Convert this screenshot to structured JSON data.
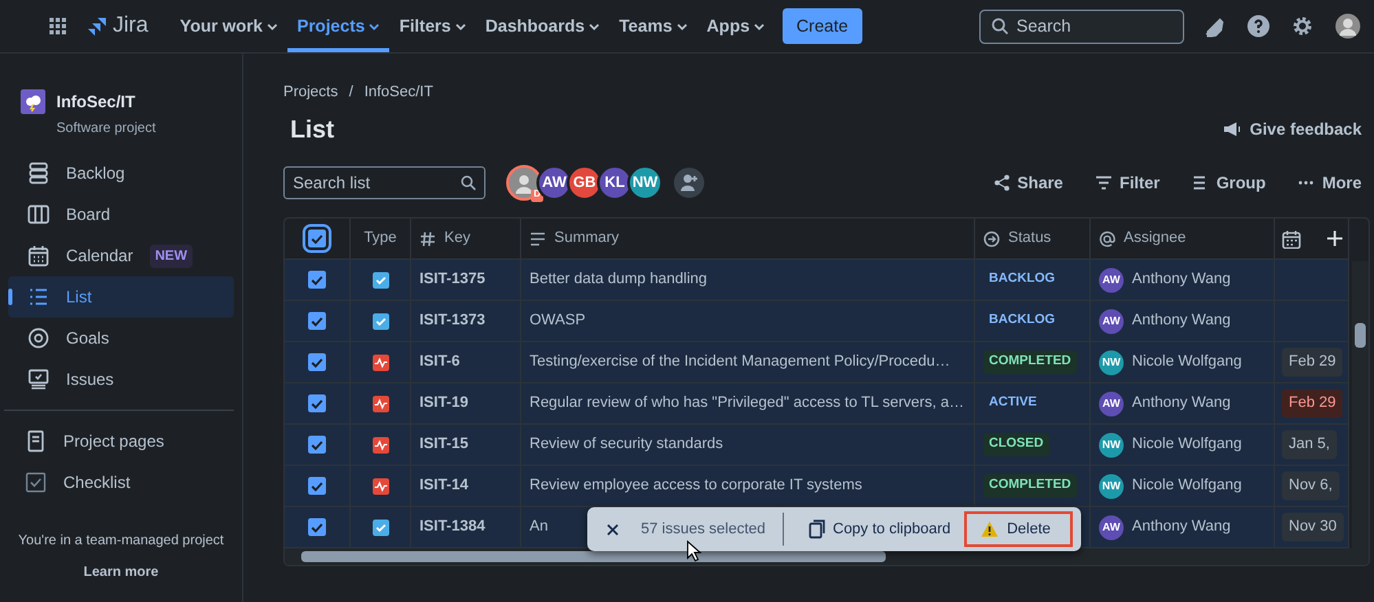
{
  "topnav": {
    "product": "Jira",
    "items": [
      {
        "label": "Your work",
        "selected": false
      },
      {
        "label": "Projects",
        "selected": true
      },
      {
        "label": "Filters",
        "selected": false
      },
      {
        "label": "Dashboards",
        "selected": false
      },
      {
        "label": "Teams",
        "selected": false
      },
      {
        "label": "Apps",
        "selected": false
      }
    ],
    "create": "Create",
    "search": {
      "placeholder": "Search"
    }
  },
  "sidebar": {
    "project": {
      "name": "InfoSec/IT",
      "type": "Software project"
    },
    "items": [
      {
        "kind": "backlog",
        "label": "Backlog",
        "selected": false
      },
      {
        "kind": "board",
        "label": "Board",
        "selected": false
      },
      {
        "kind": "calendar",
        "label": "Calendar",
        "badge": "NEW",
        "selected": false
      },
      {
        "kind": "list",
        "label": "List",
        "selected": true
      },
      {
        "kind": "goals",
        "label": "Goals",
        "selected": false
      },
      {
        "kind": "issues",
        "label": "Issues",
        "selected": false
      }
    ],
    "secondary": [
      {
        "kind": "pages",
        "label": "Project pages"
      },
      {
        "kind": "checklist",
        "label": "Checklist"
      }
    ],
    "footer": {
      "text": "You're in a team-managed project",
      "link": "Learn more"
    }
  },
  "breadcrumbs": [
    "Projects",
    "InfoSec/IT"
  ],
  "breadcrumb_separator": "/",
  "title": "List",
  "feedback": "Give feedback",
  "search_list": {
    "placeholder": "Search list"
  },
  "avatars": [
    {
      "kind": "photo",
      "badge": "D"
    },
    {
      "kind": "initials",
      "initials": "AW",
      "color": "#5e4db2"
    },
    {
      "kind": "initials",
      "initials": "GB",
      "color": "#e2483d"
    },
    {
      "kind": "initials",
      "initials": "KL",
      "color": "#5e4db2"
    },
    {
      "kind": "initials",
      "initials": "NW",
      "color": "#1d9aaa"
    },
    {
      "kind": "add"
    }
  ],
  "actions": [
    {
      "kind": "share",
      "label": "Share"
    },
    {
      "kind": "filter",
      "label": "Filter"
    },
    {
      "kind": "group",
      "label": "Group"
    },
    {
      "kind": "more",
      "label": "More"
    }
  ],
  "table": {
    "all_checked": true,
    "columns": [
      {
        "kind": "type",
        "label": "Type"
      },
      {
        "kind": "key",
        "label": "Key"
      },
      {
        "kind": "summary",
        "label": "Summary"
      },
      {
        "kind": "status",
        "label": "Status"
      },
      {
        "kind": "assignee",
        "label": "Assignee"
      }
    ],
    "rows": [
      {
        "selected": true,
        "kind": "task",
        "key": "ISIT-1375",
        "summary": "Better data dump handling",
        "status": {
          "text": "BACKLOG",
          "kind": "todo"
        },
        "assignee": {
          "initials": "AW",
          "name": "Anthony Wang",
          "color": "#5e4db2"
        }
      },
      {
        "selected": true,
        "kind": "task",
        "key": "ISIT-1373",
        "summary": "OWASP",
        "status": {
          "text": "BACKLOG",
          "kind": "todo"
        },
        "assignee": {
          "initials": "AW",
          "name": "Anthony Wang",
          "color": "#5e4db2"
        }
      },
      {
        "selected": true,
        "kind": "bug",
        "key": "ISIT-6",
        "summary": "Testing/exercise of the Incident Management Policy/Procedu…",
        "status": {
          "text": "COMPLETED",
          "kind": "done"
        },
        "assignee": {
          "initials": "NW",
          "name": "Nicole Wolfgang",
          "color": "#1d9aaa"
        },
        "date": {
          "text": "Feb 29",
          "overdue": false
        }
      },
      {
        "selected": true,
        "kind": "bug",
        "key": "ISIT-19",
        "summary": "Regular review of who has \"Privileged\" access to TL servers, a…",
        "status": {
          "text": "ACTIVE",
          "kind": "progress"
        },
        "assignee": {
          "initials": "AW",
          "name": "Anthony Wang",
          "color": "#5e4db2"
        },
        "date": {
          "text": "Feb 29",
          "overdue": true
        }
      },
      {
        "selected": true,
        "kind": "bug",
        "key": "ISIT-15",
        "summary": "Review of security standards",
        "status": {
          "text": "CLOSED",
          "kind": "done"
        },
        "assignee": {
          "initials": "NW",
          "name": "Nicole Wolfgang",
          "color": "#1d9aaa"
        },
        "date": {
          "text": "Jan 5,",
          "overdue": false
        }
      },
      {
        "selected": true,
        "kind": "bug",
        "key": "ISIT-14",
        "summary": "Review employee access to corporate IT systems",
        "status": {
          "text": "COMPLETED",
          "kind": "done"
        },
        "assignee": {
          "initials": "NW",
          "name": "Nicole Wolfgang",
          "color": "#1d9aaa"
        },
        "date": {
          "text": "Nov 6,",
          "overdue": false
        }
      },
      {
        "selected": true,
        "kind": "task",
        "key": "ISIT-1384",
        "summary": "An",
        "status": null,
        "assignee": {
          "initials": "AW",
          "name": "Anthony Wang",
          "color": "#5e4db2"
        },
        "date": {
          "text": "Nov 30",
          "overdue": false
        }
      }
    ]
  },
  "selection_bar": {
    "count": "57 issues selected",
    "copy": "Copy to clipboard",
    "delete": {
      "label": "Delete",
      "highlighted": true
    }
  }
}
